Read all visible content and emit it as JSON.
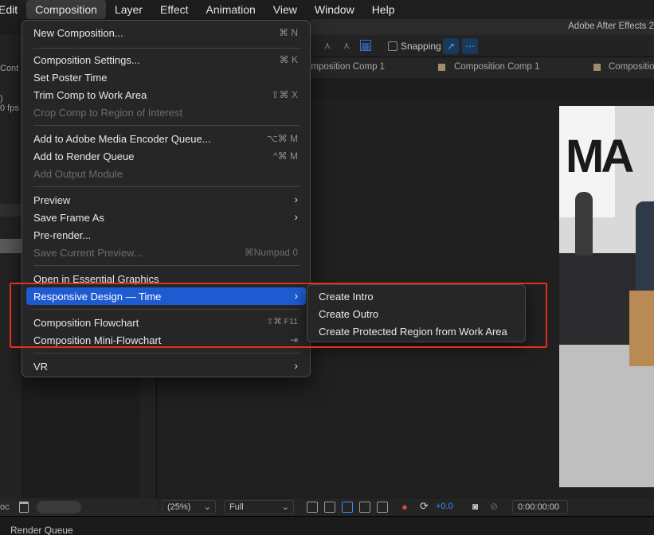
{
  "menubar": {
    "items": [
      "Edit",
      "Composition",
      "Layer",
      "Effect",
      "Animation",
      "View",
      "Window",
      "Help"
    ],
    "active": "Composition"
  },
  "app": {
    "title": "Adobe After Effects 2"
  },
  "toolbar": {
    "snapping_label": "Snapping"
  },
  "left_panel": {
    "fragments": [
      "Cont",
      ")",
      "0 fps"
    ],
    "bottom_text": "oc"
  },
  "tabs": [
    "omposition Comp 1",
    "Composition Comp 1",
    "Compositio"
  ],
  "composition_menu": {
    "items": [
      {
        "label": "New Composition...",
        "shortcut": "⌘ N",
        "enabled": true,
        "submenu": false
      },
      {
        "label": "Composition Settings...",
        "shortcut": "⌘ K",
        "enabled": true,
        "submenu": false
      },
      {
        "label": "Set Poster Time",
        "shortcut": "",
        "enabled": true,
        "submenu": false
      },
      {
        "label": "Trim Comp to Work Area",
        "shortcut": "⇧⌘ X",
        "enabled": true,
        "submenu": false
      },
      {
        "label": "Crop Comp to Region of Interest",
        "shortcut": "",
        "enabled": false,
        "submenu": false
      },
      {
        "label": "Add to Adobe Media Encoder Queue...",
        "shortcut": "⌥⌘ M",
        "enabled": true,
        "submenu": false
      },
      {
        "label": "Add to Render Queue",
        "shortcut": "^⌘ M",
        "enabled": true,
        "submenu": false
      },
      {
        "label": "Add Output Module",
        "shortcut": "",
        "enabled": false,
        "submenu": false
      },
      {
        "label": "Preview",
        "shortcut": "",
        "enabled": true,
        "submenu": true
      },
      {
        "label": "Save Frame As",
        "shortcut": "",
        "enabled": true,
        "submenu": true
      },
      {
        "label": "Pre-render...",
        "shortcut": "",
        "enabled": true,
        "submenu": false
      },
      {
        "label": "Save Current Preview...",
        "shortcut": "⌘Numpad 0",
        "enabled": false,
        "submenu": false
      },
      {
        "label": "Open in Essential Graphics",
        "shortcut": "",
        "enabled": true,
        "submenu": false
      },
      {
        "label": "Responsive Design — Time",
        "shortcut": "",
        "enabled": true,
        "submenu": true,
        "highlighted": true
      },
      {
        "label": "Composition Flowchart",
        "shortcut": "⇧⌘ F11",
        "enabled": true,
        "submenu": false
      },
      {
        "label": "Composition Mini-Flowchart",
        "shortcut": "⇥",
        "enabled": true,
        "submenu": false
      },
      {
        "label": "VR",
        "shortcut": "",
        "enabled": true,
        "submenu": true
      }
    ]
  },
  "responsive_submenu": {
    "items": [
      "Create Intro",
      "Create Outro",
      "Create Protected Region from Work Area"
    ]
  },
  "viewer_bottom": {
    "zoom": "(25%)",
    "resolution": "Full",
    "exposure": "+0.0",
    "timecode": "0:00:00:00"
  },
  "render_queue": {
    "label": "Render Queue"
  },
  "colors": {
    "highlight": "#1f5bd0",
    "callout": "#e03020"
  }
}
